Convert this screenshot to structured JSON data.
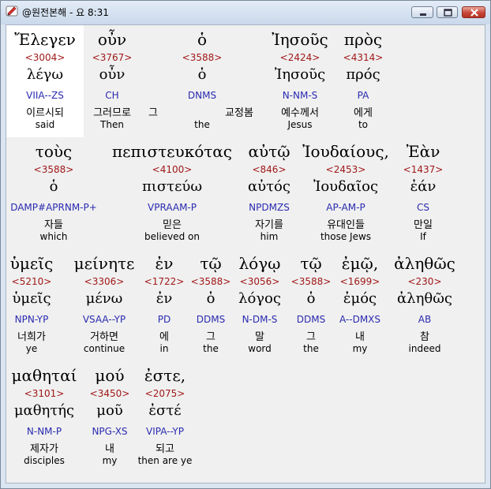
{
  "window": {
    "title": "@원전본해 - 요 8:31",
    "icon": "book-icon",
    "controls": [
      "minimize-icon",
      "maximize-icon",
      "close-icon"
    ]
  },
  "colors": {
    "strongs": "#a01818",
    "morph": "#2a2ab0",
    "selected_bg": "#ffffff"
  },
  "rows": [
    {
      "words": [
        {
          "gk": "Ἔλεγεν",
          "num": "<3004>",
          "lex": "λέγω",
          "morph": "VIIA--ZS",
          "kor": "이르시되",
          "eng": "said"
        },
        {
          "gk": "οὖν",
          "num": "<3767>",
          "lex": "οὖν",
          "morph": "CH",
          "kor": "그러므로",
          "eng": "Then"
        },
        {
          "gk": "",
          "num": "",
          "lex": "",
          "morph": "",
          "kor": "그",
          "eng": ""
        },
        {
          "gk": "ὁ",
          "num": "<3588>",
          "lex": "ὁ",
          "morph": "DNMS",
          "kor": "",
          "eng": "the"
        },
        {
          "gk": "",
          "num": "",
          "lex": "",
          "morph": "",
          "kor": "교정봄",
          "eng": ""
        },
        {
          "gk": "Ἰησοῦς",
          "num": "<2424>",
          "lex": "Ἰησοῦς",
          "morph": "N-NM-S",
          "kor": "예수께서",
          "eng": "Jesus"
        },
        {
          "gk": "πρὸς",
          "num": "<4314>",
          "lex": "πρός",
          "morph": "PA",
          "kor": "에게",
          "eng": "to"
        }
      ]
    },
    {
      "words": [
        {
          "gk": "τοὺς",
          "num": "<3588>",
          "lex": "ὁ",
          "morph": "DAMP#APRNM-P+",
          "kor": "자들",
          "eng": "which"
        },
        {
          "gk": "πεπιστευκότας",
          "num": "<4100>",
          "lex": "πιστεύω",
          "morph": "VPRAAM-P",
          "kor": "믿은",
          "eng": "believed on"
        },
        {
          "gk": "αὐτῷ",
          "num": "<846>",
          "lex": "αὐτός",
          "morph": "NPDMZS",
          "kor": "자기를",
          "eng": "him"
        },
        {
          "gk": "Ἰουδαίους,",
          "num": "<2453>",
          "lex": "Ἰουδαῖος",
          "morph": "AP-AM-P",
          "kor": "유대인들",
          "eng": "those Jews"
        },
        {
          "gk": "Ἐὰν",
          "num": "<1437>",
          "lex": "ἐάν",
          "morph": "CS",
          "kor": "만일",
          "eng": "If"
        }
      ]
    },
    {
      "words": [
        {
          "gk": "ὑμεῖς",
          "num": "<5210>",
          "lex": "ὑμεῖς",
          "morph": "NPN-YP",
          "kor": "너희가",
          "eng": "ye"
        },
        {
          "gk": "μείνητε",
          "num": "<3306>",
          "lex": "μένω",
          "morph": "VSAA--YP",
          "kor": "거하면",
          "eng": "continue"
        },
        {
          "gk": "ἐν",
          "num": "<1722>",
          "lex": "ἐν",
          "morph": "PD",
          "kor": "에",
          "eng": "in"
        },
        {
          "gk": "τῷ",
          "num": "<3588>",
          "lex": "ὁ",
          "morph": "DDMS",
          "kor": "그",
          "eng": "the"
        },
        {
          "gk": "λόγῳ",
          "num": "<3056>",
          "lex": "λόγος",
          "morph": "N-DM-S",
          "kor": "말",
          "eng": "word"
        },
        {
          "gk": "τῷ",
          "num": "<3588>",
          "lex": "ὁ",
          "morph": "DDMS",
          "kor": "그",
          "eng": "the"
        },
        {
          "gk": "ἐμῷ,",
          "num": "<1699>",
          "lex": "ἐμός",
          "morph": "A--DMXS",
          "kor": "내",
          "eng": "my"
        },
        {
          "gk": "ἀληθῶς",
          "num": "<230>",
          "lex": "ἀληθῶς",
          "morph": "AB",
          "kor": "참",
          "eng": "indeed"
        }
      ]
    },
    {
      "words": [
        {
          "gk": "μαθηταί",
          "num": "<3101>",
          "lex": "μαθητής",
          "morph": "N-NM-P",
          "kor": "제자가",
          "eng": "disciples"
        },
        {
          "gk": "μού",
          "num": "<3450>",
          "lex": "μοῦ",
          "morph": "NPG-XS",
          "kor": "내",
          "eng": "my"
        },
        {
          "gk": "ἐστε,",
          "num": "<2075>",
          "lex": "ἐστέ",
          "morph": "VIPA--YP",
          "kor": "되고",
          "eng": "then are ye"
        }
      ]
    }
  ]
}
